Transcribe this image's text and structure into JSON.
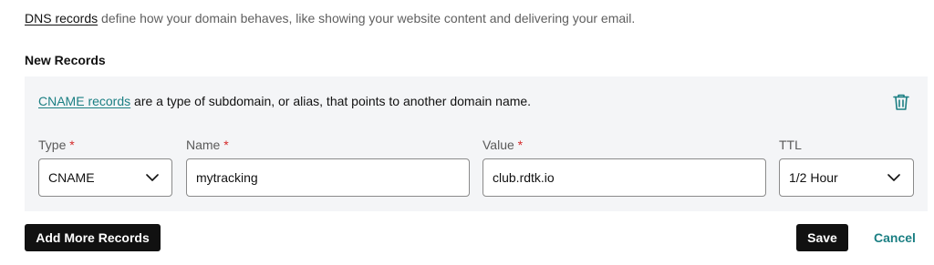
{
  "intro": {
    "link_text": "DNS records",
    "text": " define how your domain behaves, like showing your website content and delivering your email."
  },
  "section_title": "New Records",
  "record": {
    "info_link": "CNAME records",
    "info_text": " are a type of subdomain, or alias, that points to another domain name.",
    "delete_icon": "trash-icon",
    "fields": {
      "type": {
        "label": "Type",
        "required_mark": "*",
        "value": "CNAME"
      },
      "name": {
        "label": "Name",
        "required_mark": "*",
        "value": "mytracking"
      },
      "value": {
        "label": "Value",
        "required_mark": "*",
        "value": "club.rdtk.io"
      },
      "ttl": {
        "label": "TTL",
        "value": "1/2 Hour"
      }
    }
  },
  "actions": {
    "add_more": "Add More Records",
    "save": "Save",
    "cancel": "Cancel"
  },
  "colors": {
    "accent": "#1b7f83",
    "required": "#d52a2a",
    "panel_bg": "#f4f5f7",
    "button_dark": "#111111"
  }
}
